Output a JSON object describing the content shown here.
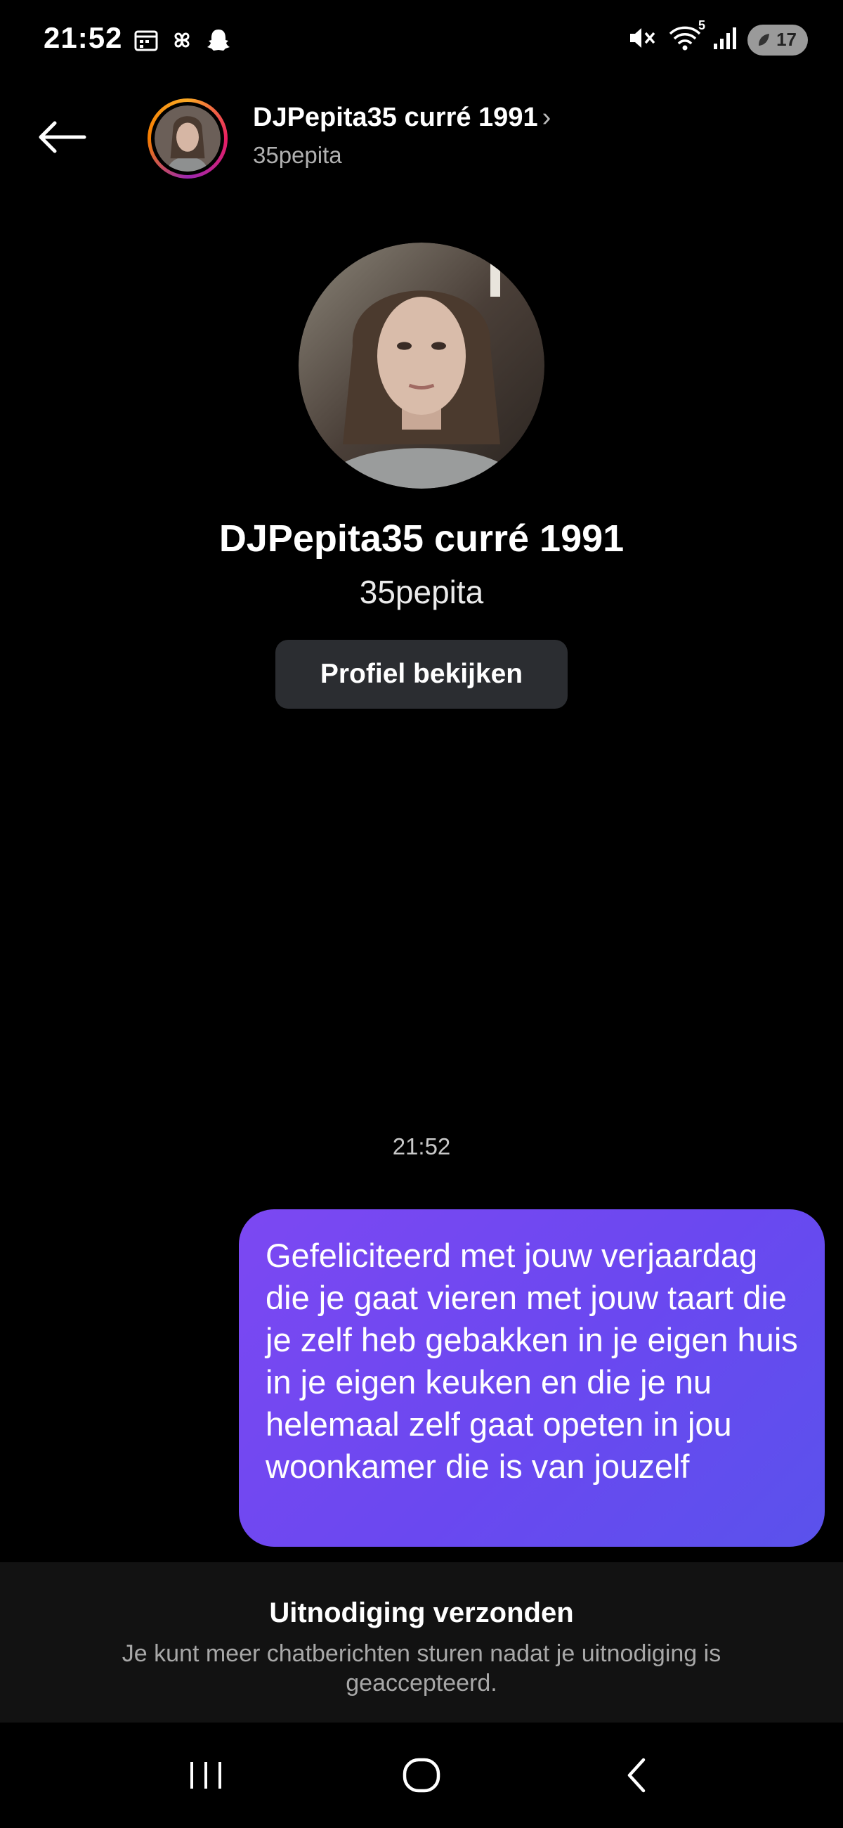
{
  "status_bar": {
    "time": "21:52",
    "battery_level": "17",
    "wifi_badge": "5",
    "icons_left": [
      "calendar-icon",
      "pinwheel-icon",
      "snapchat-icon"
    ],
    "icons_right": [
      "mute-icon",
      "wifi-icon",
      "signal-icon",
      "battery-icon"
    ]
  },
  "header": {
    "name": "DJPepita35 curré 1991",
    "chevron": "›",
    "username": "35pepita"
  },
  "profile": {
    "name": "DJPepita35 curré 1991",
    "username": "35pepita",
    "view_button": "Profiel bekijken"
  },
  "messages": [
    {
      "timestamp": "21:52",
      "text": "Gefeliciteerd met jouw verjaardag die je gaat vieren met jouw taart die je zelf heb gebakken in je eigen huis in je eigen keuken en die je nu helemaal zelf gaat opeten in jou woonkamer die is van jouzelf",
      "outgoing": true
    }
  ],
  "invite": {
    "title": "Uitnodiging verzonden",
    "description": "Je kunt meer chatberichten sturen nadat je uitnodiging is geaccepteerd."
  },
  "navbar": {
    "buttons": [
      "recents-icon",
      "home-icon",
      "back-icon"
    ]
  },
  "colors": {
    "bubble_start": "#7c48f2",
    "bubble_end": "#5a52ec",
    "background": "#000000",
    "panel": "#121212"
  }
}
